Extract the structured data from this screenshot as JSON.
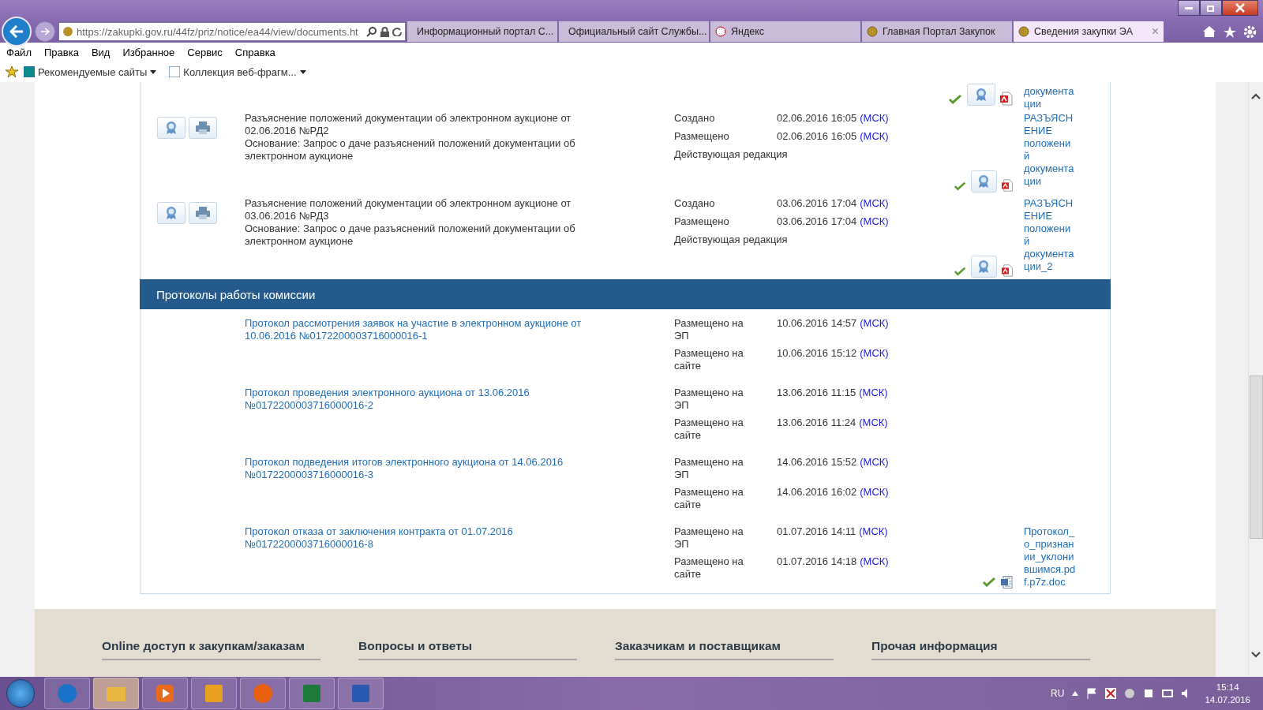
{
  "address_bar": {
    "url": "https://zakupki.gov.ru/44fz/priz/notice/ea44/view/documents.ht"
  },
  "tabs": [
    {
      "label": "Информационный портал С...",
      "selected": false
    },
    {
      "label": "Официальный сайт Службы...",
      "selected": false
    },
    {
      "label": "Яндекс",
      "selected": false
    },
    {
      "label": "Главная Портал Закупок",
      "selected": false
    },
    {
      "label": "Сведения закупки ЭА",
      "selected": true,
      "close": "×"
    }
  ],
  "menu": [
    "Файл",
    "Правка",
    "Вид",
    "Избранное",
    "Сервис",
    "Справка"
  ],
  "favorites_bar": [
    "Рекомендуемые сайты",
    "Коллекция веб-фрагм..."
  ],
  "documents": {
    "partial_row": {
      "attachment": "документа ции"
    },
    "rows": [
      {
        "title": "Разъяснение положений документации об электронном аукционе от 02.06.2016 №РД2",
        "basis": "Основание: Запрос о даче разъяснений положений документации об электронном аукционе",
        "meta": [
          {
            "label": "Создано",
            "date": "02.06.2016 16:05",
            "tz": "(МСК)"
          },
          {
            "label": "Размещено",
            "date": "02.06.2016 16:05",
            "tz": "(МСК)"
          }
        ],
        "status": "Действующая редакция",
        "attachment": "РАЗЪЯСНЕНИЕ положений документации"
      },
      {
        "title": "Разъяснение положений документации об электронном аукционе от 03.06.2016 №РД3",
        "basis": "Основание: Запрос о даче разъяснений положений документации об электронном аукционе",
        "meta": [
          {
            "label": "Создано",
            "date": "03.06.2016 17:04",
            "tz": "(МСК)"
          },
          {
            "label": "Размещено",
            "date": "03.06.2016 17:04",
            "tz": "(МСК)"
          }
        ],
        "status": "Действующая редакция",
        "attachment": "РАЗЪЯСНЕНИЕ положений документации_2"
      }
    ]
  },
  "protocols": {
    "title": "Протоколы работы комиссии",
    "rows": [
      {
        "title": "Протокол рассмотрения заявок на участие в электронном аукционе от 10.06.2016 №0172200003716000016-1",
        "meta": [
          {
            "label": "Размещено на ЭП",
            "date": "10.06.2016 14:57",
            "tz": "(МСК)"
          },
          {
            "label": "Размещено на сайте",
            "date": "10.06.2016 15:12",
            "tz": "(МСК)"
          }
        ]
      },
      {
        "title": "Протокол проведения электронного аукциона от 13.06.2016 №0172200003716000016-2",
        "meta": [
          {
            "label": "Размещено на ЭП",
            "date": "13.06.2016 11:15",
            "tz": "(МСК)"
          },
          {
            "label": "Размещено на сайте",
            "date": "13.06.2016 11:24",
            "tz": "(МСК)"
          }
        ]
      },
      {
        "title": "Протокол подведения итогов электронного аукциона от 14.06.2016 №0172200003716000016-3",
        "meta": [
          {
            "label": "Размещено на ЭП",
            "date": "14.06.2016 15:52",
            "tz": "(МСК)"
          },
          {
            "label": "Размещено на сайте",
            "date": "14.06.2016 16:02",
            "tz": "(МСК)"
          }
        ]
      },
      {
        "title": "Протокол отказа от заключения контракта от 01.07.2016 №0172200003716000016-8",
        "meta": [
          {
            "label": "Размещено на ЭП",
            "date": "01.07.2016 14:11",
            "tz": "(МСК)"
          },
          {
            "label": "Размещено на сайте",
            "date": "01.07.2016 14:18",
            "tz": "(МСК)"
          }
        ],
        "attachment": "Протокол_о_признании_уклонившимся.pdf.p7z.doc"
      }
    ]
  },
  "footer": {
    "headings": [
      "Online доступ к закупкам/заказам",
      "Вопросы и ответы",
      "Заказчикам и поставщикам",
      "Прочая информация"
    ]
  },
  "taskbar": {
    "language": "RU",
    "time": "15:14",
    "date": "14.07.2016"
  }
}
